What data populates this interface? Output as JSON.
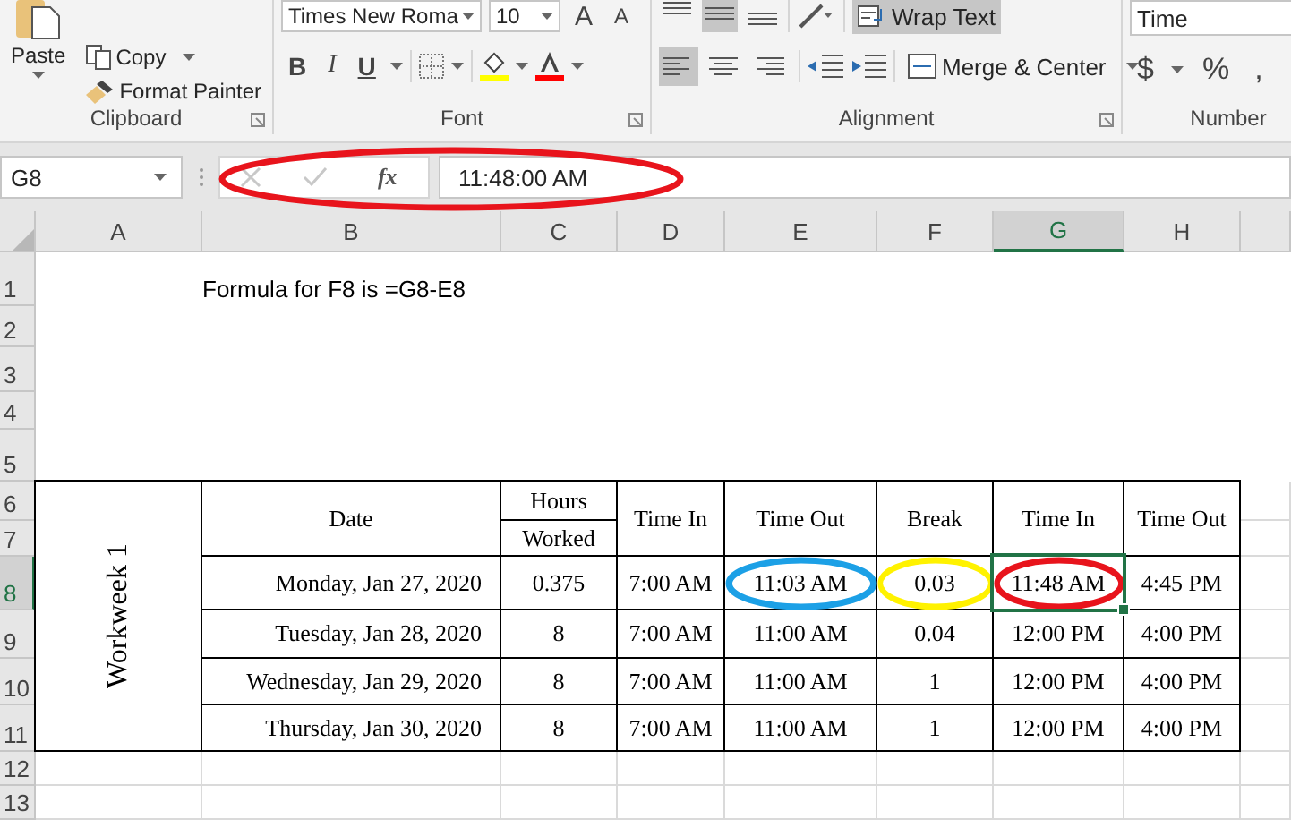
{
  "ribbon": {
    "groups": [
      {
        "kind": "clipboard",
        "label": "Clipboard",
        "paste": "Paste",
        "items": [
          "Copy",
          "Format Painter"
        ]
      },
      {
        "kind": "font",
        "label": "Font",
        "font_name": "Times New Roma",
        "font_size": "10",
        "grow": "A",
        "shrink": "A",
        "styles": [
          "B",
          "I",
          "U"
        ]
      },
      {
        "kind": "alignment",
        "label": "Alignment",
        "vertical_align": [
          {
            "selected": false
          },
          {
            "selected": true
          },
          {
            "selected": false
          }
        ],
        "horizontal_align": [
          {
            "selected": true
          },
          {
            "selected": false
          },
          {
            "selected": false
          }
        ],
        "wrap_text": {
          "label": "Wrap Text",
          "selected": true
        },
        "merge": "Merge & Center"
      },
      {
        "kind": "number",
        "label": "Number",
        "format": "Time",
        "symbols": [
          "$",
          "%",
          ","
        ]
      }
    ]
  },
  "formula_bar": {
    "name_box": "G8",
    "fx": "fx",
    "value": "11:48:00 AM",
    "circle": {
      "color": "#e8141c"
    }
  },
  "sheet": {
    "columns": [
      {
        "label": "A",
        "selected": false
      },
      {
        "label": "B",
        "selected": false
      },
      {
        "label": "C",
        "selected": false
      },
      {
        "label": "D",
        "selected": false
      },
      {
        "label": "E",
        "selected": false
      },
      {
        "label": "F",
        "selected": false
      },
      {
        "label": "G",
        "selected": true
      },
      {
        "label": "H",
        "selected": false
      }
    ],
    "rows": [
      {
        "label": "1",
        "selected": false
      },
      {
        "label": "2",
        "selected": false
      },
      {
        "label": "3",
        "selected": false
      },
      {
        "label": "4",
        "selected": false
      },
      {
        "label": "5",
        "selected": false
      },
      {
        "label": "6",
        "selected": false
      },
      {
        "label": "7",
        "selected": false
      },
      {
        "label": "8",
        "selected": true
      },
      {
        "label": "9",
        "selected": false
      },
      {
        "label": "10",
        "selected": false
      },
      {
        "label": "11",
        "selected": false
      },
      {
        "label": "12",
        "selected": false
      },
      {
        "label": "13",
        "selected": false
      }
    ],
    "note": "Formula for F8 is =G8-E8",
    "table": {
      "side_label": "Workweek 1",
      "headers": [
        {
          "text": "Date"
        },
        {
          "text": "Hours",
          "text2": "Worked"
        },
        {
          "text": "Time In"
        },
        {
          "text": "Time Out"
        },
        {
          "text": "Break"
        },
        {
          "text": "Time In"
        },
        {
          "text": "Time Out"
        }
      ],
      "rows": [
        {
          "cells": [
            {
              "text": "Monday, Jan 27, 2020"
            },
            {
              "text": "0.375"
            },
            {
              "text": "7:00 AM"
            },
            {
              "text": "11:03 AM",
              "circle": {
                "color": "#1ca0e6"
              }
            },
            {
              "text": "0.03",
              "circle": {
                "color": "#fff200"
              }
            },
            {
              "text": "11:48 AM",
              "circle": {
                "color": "#e8141c"
              }
            },
            {
              "text": "4:45 PM"
            }
          ]
        },
        {
          "cells": [
            {
              "text": "Tuesday, Jan 28, 2020"
            },
            {
              "text": "8"
            },
            {
              "text": "7:00 AM"
            },
            {
              "text": "11:00 AM"
            },
            {
              "text": "0.04"
            },
            {
              "text": "12:00 PM"
            },
            {
              "text": "4:00 PM"
            }
          ]
        },
        {
          "cells": [
            {
              "text": "Wednesday, Jan 29, 2020"
            },
            {
              "text": "8"
            },
            {
              "text": "7:00 AM"
            },
            {
              "text": "11:00 AM"
            },
            {
              "text": "1"
            },
            {
              "text": "12:00 PM"
            },
            {
              "text": "4:00 PM"
            }
          ]
        },
        {
          "cells": [
            {
              "text": "Thursday, Jan 30, 2020"
            },
            {
              "text": "8"
            },
            {
              "text": "7:00 AM"
            },
            {
              "text": "11:00 AM"
            },
            {
              "text": "1"
            },
            {
              "text": "12:00 PM"
            },
            {
              "text": "4:00 PM"
            }
          ]
        }
      ]
    }
  }
}
